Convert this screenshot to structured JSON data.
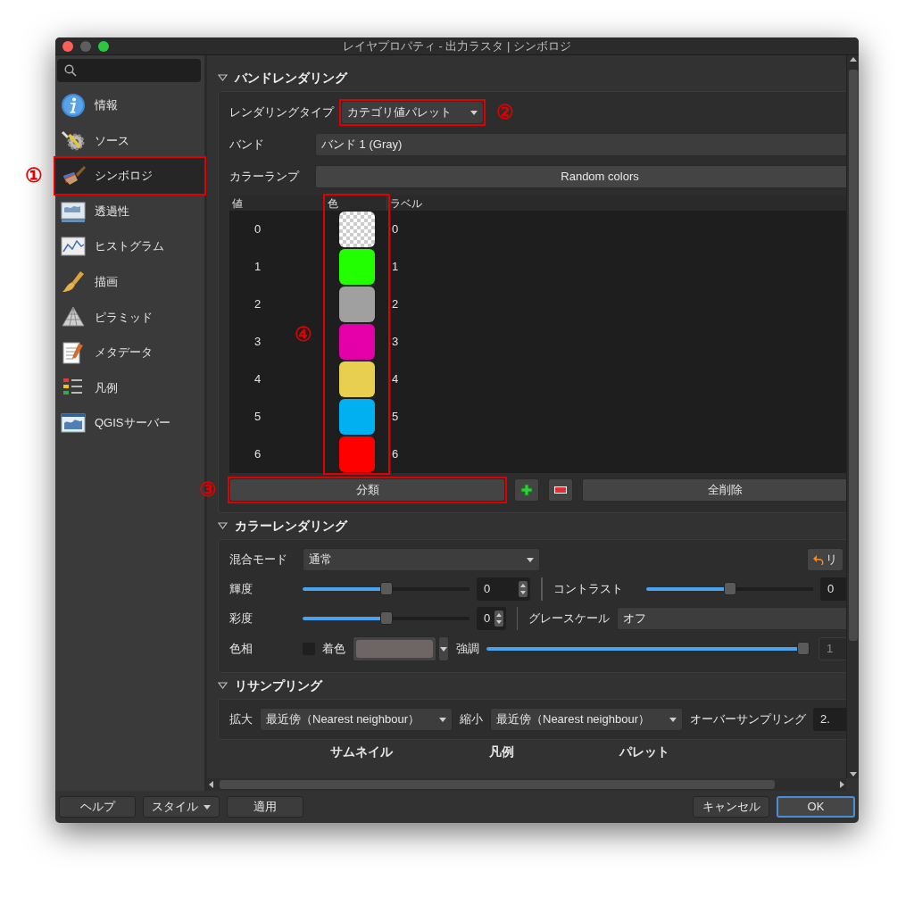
{
  "window": {
    "title": "レイヤプロパティ - 出力ラスタ | シンボロジ"
  },
  "sidebar": {
    "items": [
      {
        "label": "情報",
        "kind": "info",
        "selected": false
      },
      {
        "label": "ソース",
        "kind": "source",
        "selected": false
      },
      {
        "label": "シンボロジ",
        "kind": "symbology",
        "selected": true,
        "annotation": "①"
      },
      {
        "label": "透過性",
        "kind": "transparency",
        "selected": false
      },
      {
        "label": "ヒストグラム",
        "kind": "histogram",
        "selected": false
      },
      {
        "label": "描画",
        "kind": "rendering",
        "selected": false
      },
      {
        "label": "ピラミッド",
        "kind": "pyramid",
        "selected": false
      },
      {
        "label": "メタデータ",
        "kind": "metadata",
        "selected": false
      },
      {
        "label": "凡例",
        "kind": "legend",
        "selected": false
      },
      {
        "label": "QGISサーバー",
        "kind": "server",
        "selected": false
      }
    ]
  },
  "band_rendering": {
    "title": "バンドレンダリング",
    "render_type": {
      "label": "レンダリングタイプ",
      "value": "カテゴリ値パレット",
      "annotation": "②"
    },
    "band": {
      "label": "バンド",
      "value": "バンド 1 (Gray)"
    },
    "color_ramp": {
      "label": "カラーランプ",
      "value": "Random colors"
    },
    "table": {
      "columns": [
        {
          "label": "値"
        },
        {
          "label": "色",
          "annotation": "④"
        },
        {
          "label": "ラベル"
        }
      ],
      "rows": [
        {
          "value": "0",
          "kind": "transparent",
          "label": "0"
        },
        {
          "value": "1",
          "kind": "solid",
          "color": "#22ff00",
          "label": "1"
        },
        {
          "value": "2",
          "kind": "solid",
          "color": "#a0a0a0",
          "label": "2"
        },
        {
          "value": "3",
          "kind": "solid",
          "color": "#e400a8",
          "label": "3"
        },
        {
          "value": "4",
          "kind": "solid",
          "color": "#e8cf50",
          "label": "4"
        },
        {
          "value": "5",
          "kind": "solid",
          "color": "#00b0f0",
          "label": "5"
        },
        {
          "value": "6",
          "kind": "solid",
          "color": "#ff0000",
          "label": "6"
        }
      ]
    },
    "classify_button": {
      "label": "分類",
      "annotation": "③"
    },
    "delete_all_button": "全削除"
  },
  "color_rendering": {
    "title": "カラーレンダリング",
    "blend_mode": {
      "label": "混合モード",
      "value": "通常"
    },
    "reset_button": "リ",
    "brightness": {
      "label": "輝度",
      "level": 0.5,
      "value": "0"
    },
    "contrast": {
      "label": "コントラスト",
      "level": 0.5,
      "value": "0"
    },
    "saturation": {
      "label": "彩度",
      "level": 0.5,
      "value": "0"
    },
    "grayscale": {
      "label": "グレースケール",
      "value": "オフ"
    },
    "hue": {
      "label": "色相",
      "colorize": {
        "label": "着色",
        "checked": false
      },
      "strength": {
        "label": "強調",
        "level": 1.0,
        "value": "1",
        "disabled": true
      }
    }
  },
  "resampling": {
    "title": "リサンプリング",
    "zoomed_in": {
      "label": "拡大",
      "value": "最近傍（Nearest neighbour）"
    },
    "zoomed_out": {
      "label": "縮小",
      "value": "最近傍（Nearest neighbour）"
    },
    "oversampling": {
      "label": "オーバーサンプリング",
      "value": "2."
    }
  },
  "next_headings": [
    "サムネイル",
    "凡例",
    "パレット"
  ],
  "footer": {
    "help": "ヘルプ",
    "style": "スタイル",
    "apply": "適用",
    "cancel": "キャンセル",
    "ok": "OK"
  }
}
